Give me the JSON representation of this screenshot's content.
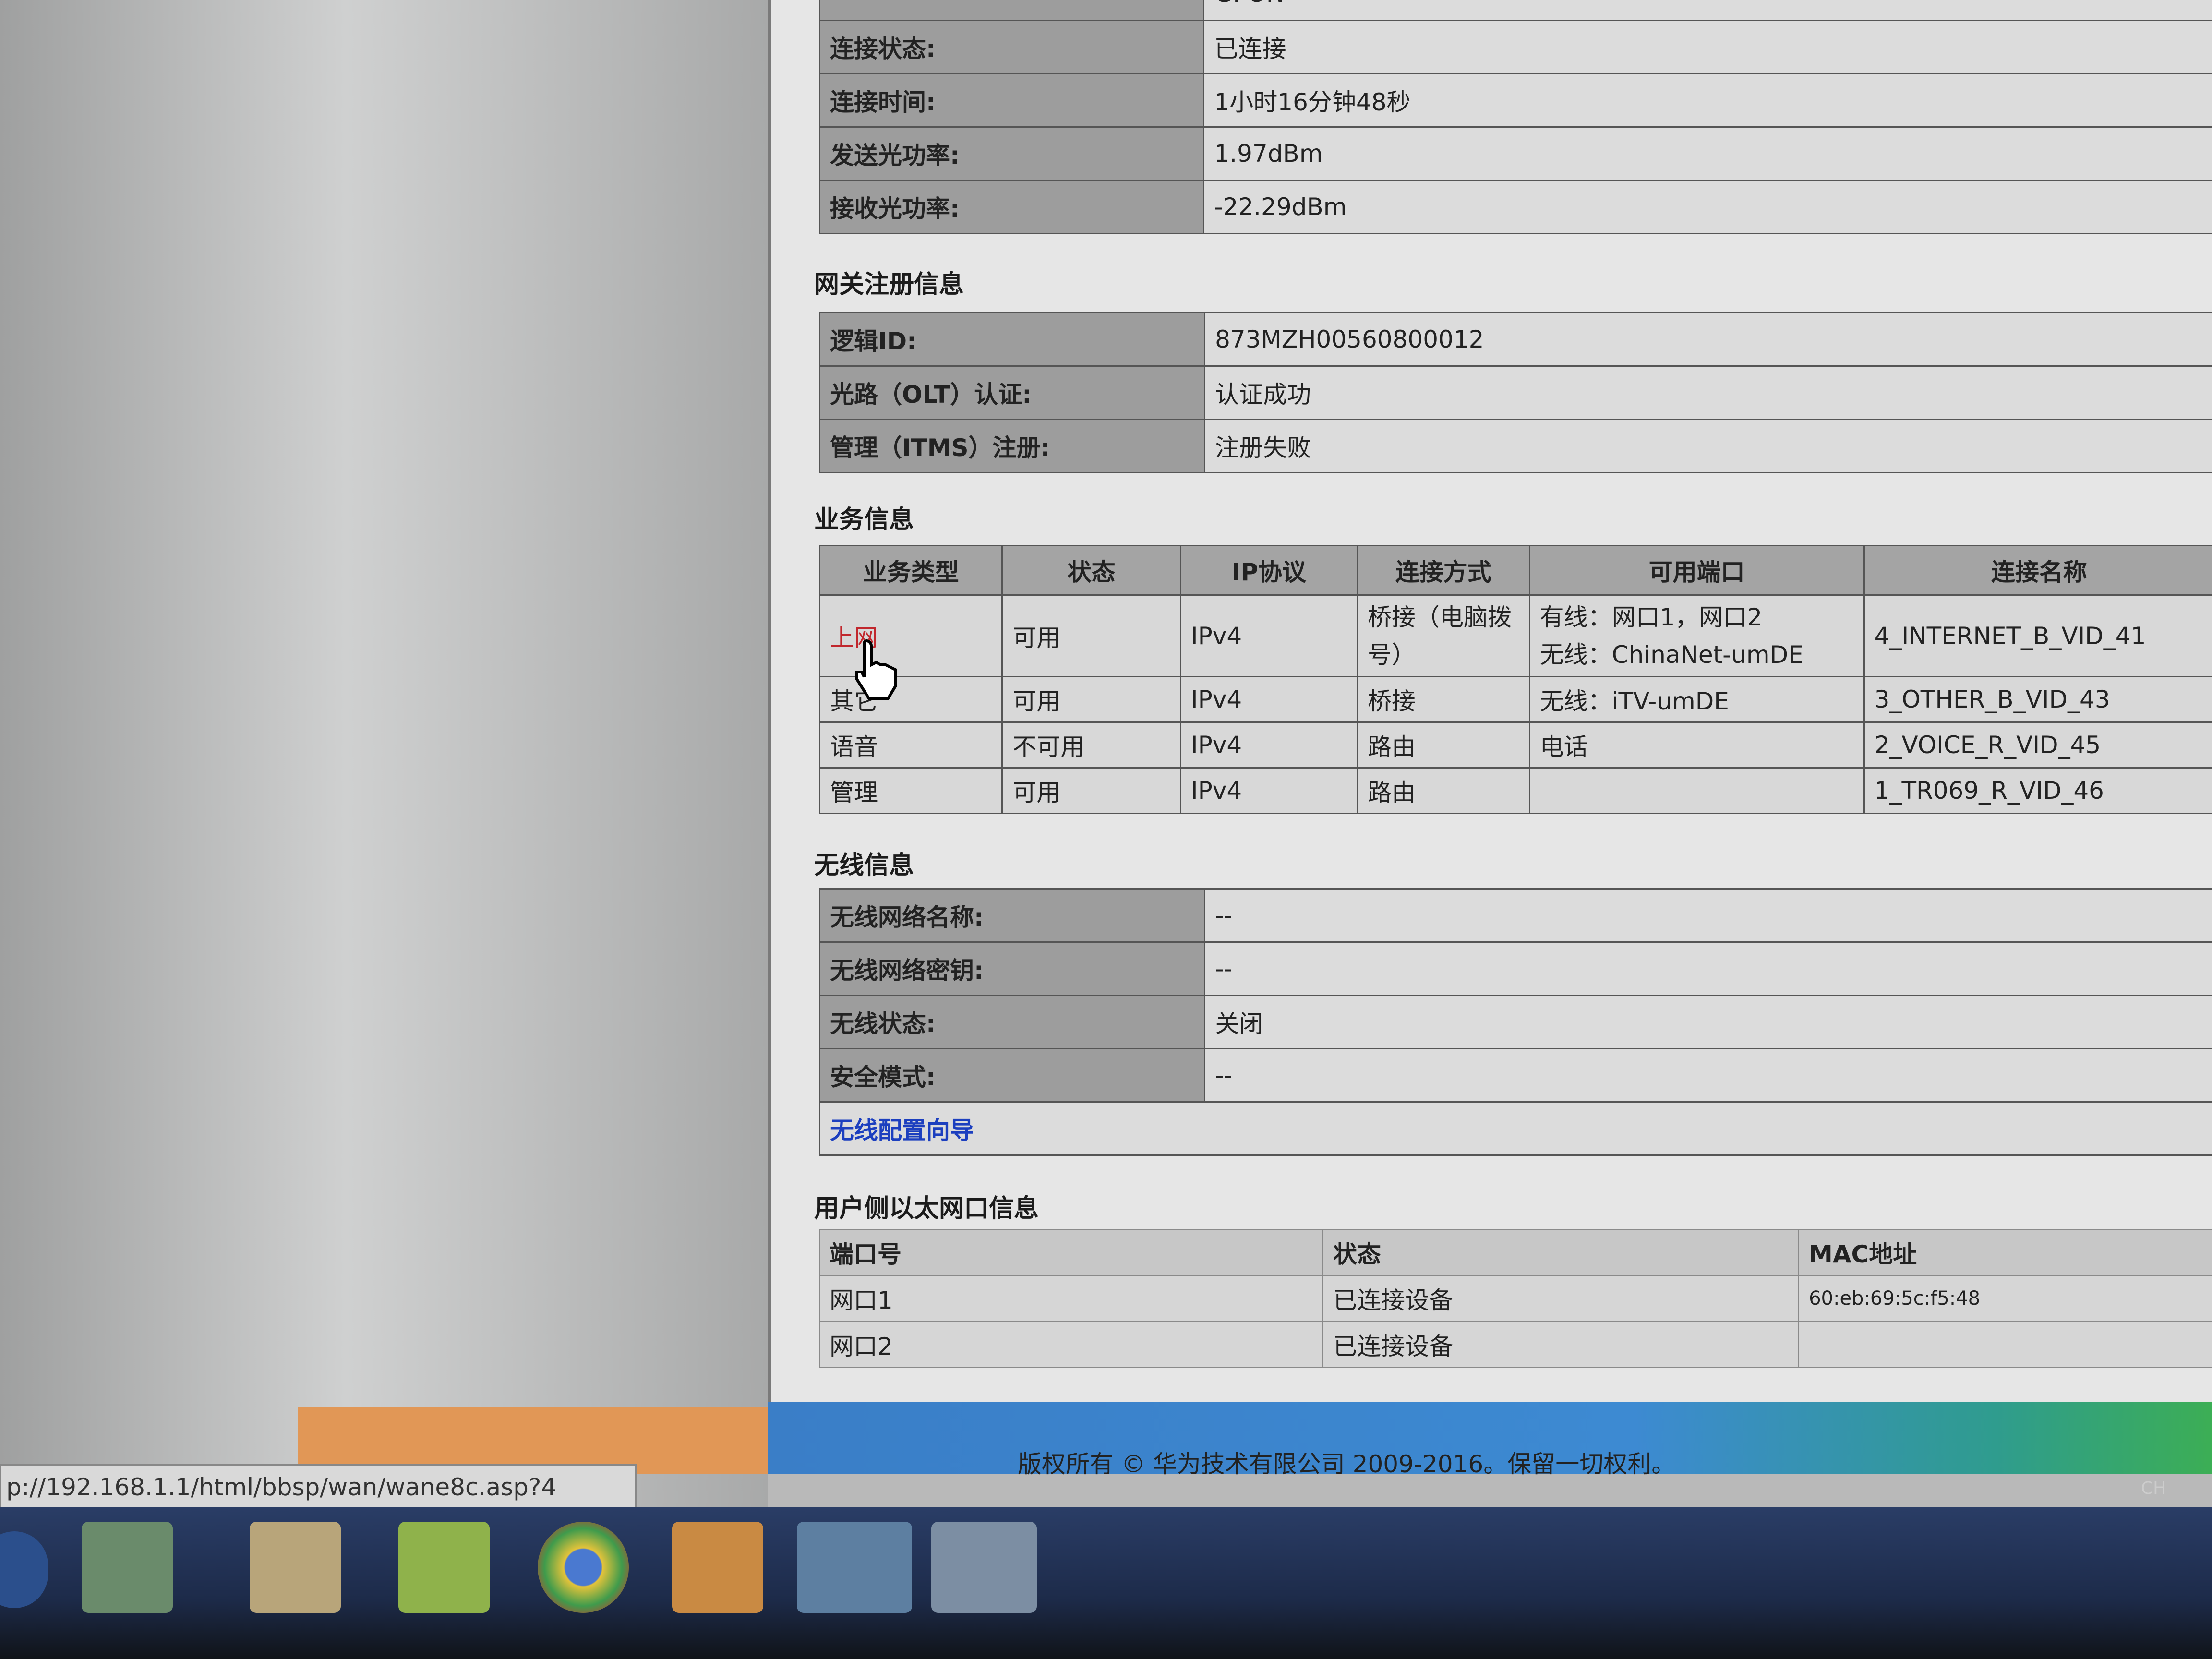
{
  "optical": {
    "type_value": "GPON",
    "rows": [
      {
        "label": "连接状态:",
        "value": "已连接"
      },
      {
        "label": "连接时间:",
        "value": "1小时16分钟48秒"
      },
      {
        "label": "发送光功率:",
        "value": "1.97dBm"
      },
      {
        "label": "接收光功率:",
        "value": "-22.29dBm"
      }
    ]
  },
  "gateway": {
    "title": "网关注册信息",
    "rows": [
      {
        "label": "逻辑ID:",
        "value": "873MZH00560800012"
      },
      {
        "label": "光路（OLT）认证:",
        "value": "认证成功"
      },
      {
        "label": "管理（ITMS）注册:",
        "value": "注册失败"
      }
    ]
  },
  "service": {
    "title": "业务信息",
    "headers": [
      "业务类型",
      "状态",
      "IP协议",
      "连接方式",
      "可用端口",
      "连接名称"
    ],
    "rows": [
      {
        "type": "上网",
        "status": "可用",
        "ip": "IPv4",
        "mode": "桥接（电脑拨号）",
        "port_line1": "有线：网口1，网口2",
        "port_line2": "无线：ChinaNet-umDE",
        "name": "4_INTERNET_B_VID_41"
      },
      {
        "type": "其它",
        "status": "可用",
        "ip": "IPv4",
        "mode": "桥接",
        "port_line1": "无线：iTV-umDE",
        "port_line2": "",
        "name": "3_OTHER_B_VID_43"
      },
      {
        "type": "语音",
        "status": "不可用",
        "ip": "IPv4",
        "mode": "路由",
        "port_line1": "电话",
        "port_line2": "",
        "name": "2_VOICE_R_VID_45"
      },
      {
        "type": "管理",
        "status": "可用",
        "ip": "IPv4",
        "mode": "路由",
        "port_line1": "",
        "port_line2": "",
        "name": "1_TR069_R_VID_46"
      }
    ]
  },
  "wireless": {
    "title": "无线信息",
    "rows": [
      {
        "label": "无线网络名称:",
        "value": "--"
      },
      {
        "label": "无线网络密钥:",
        "value": "--"
      },
      {
        "label": "无线状态:",
        "value": "关闭"
      },
      {
        "label": "安全模式:",
        "value": "--"
      }
    ],
    "wizard_link": "无线配置向导"
  },
  "ethernet": {
    "title": "用户侧以太网口信息",
    "headers": [
      "端口号",
      "状态",
      "MAC地址"
    ],
    "rows": [
      {
        "port": "网口1",
        "status": "已连接设备",
        "mac": "60:eb:69:5c:f5:48"
      },
      {
        "port": "网口2",
        "status": "已连接设备",
        "mac": ""
      }
    ]
  },
  "footer": {
    "copyright": "版权所有 © 华为技术有限公司 2009-2016。保留一切权利。"
  },
  "status_bar": {
    "url": "p://192.168.1.1/html/bbsp/wan/wane8c.asp?4"
  },
  "tray": {
    "lang": "CH"
  },
  "taskbar": {
    "apps": [
      "start-orb",
      "ie-browser",
      "file-explorer",
      "app-green",
      "chrome",
      "media-player",
      "window-app-1",
      "window-app-2"
    ]
  }
}
